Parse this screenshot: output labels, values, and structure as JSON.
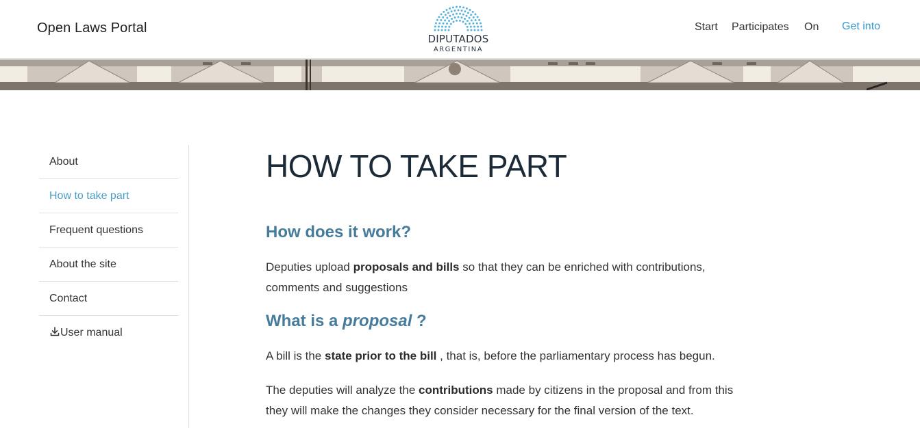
{
  "header": {
    "site_title": "Open Laws Portal",
    "logo_text": "DIPUTADOS",
    "logo_subtext": "ARGENTINA",
    "nav": {
      "start": "Start",
      "participates": "Participates",
      "on": "On",
      "get_into": "Get into"
    }
  },
  "sidebar": {
    "items": [
      {
        "label": "About"
      },
      {
        "label": "How to take part",
        "active": true
      },
      {
        "label": "Frequent questions"
      },
      {
        "label": "About the site"
      },
      {
        "label": "Contact"
      },
      {
        "label": "User manual",
        "icon": "download-icon"
      }
    ]
  },
  "main": {
    "title": "HOW TO TAKE PART",
    "section1": {
      "heading": "How does it work?",
      "text_before": "Deputies upload ",
      "bold": "proposals and bills",
      "text_after": " so that they can be enriched with contributions, comments and suggestions"
    },
    "section2": {
      "heading_before": "What is a ",
      "heading_em": "proposal",
      "heading_after": " ?",
      "p1_before": "A bill is the ",
      "p1_bold": "state prior to the bill",
      "p1_after": " , that is, before the parliamentary process has begun.",
      "p2_before": "The deputies will analyze the ",
      "p2_bold": "contributions",
      "p2_after": " made by citizens in the proposal and from this they will make the changes they consider necessary for the final version of the text."
    }
  },
  "colors": {
    "accent": "#4a9cc7",
    "heading": "#467b9c",
    "title": "#1b2a36"
  }
}
